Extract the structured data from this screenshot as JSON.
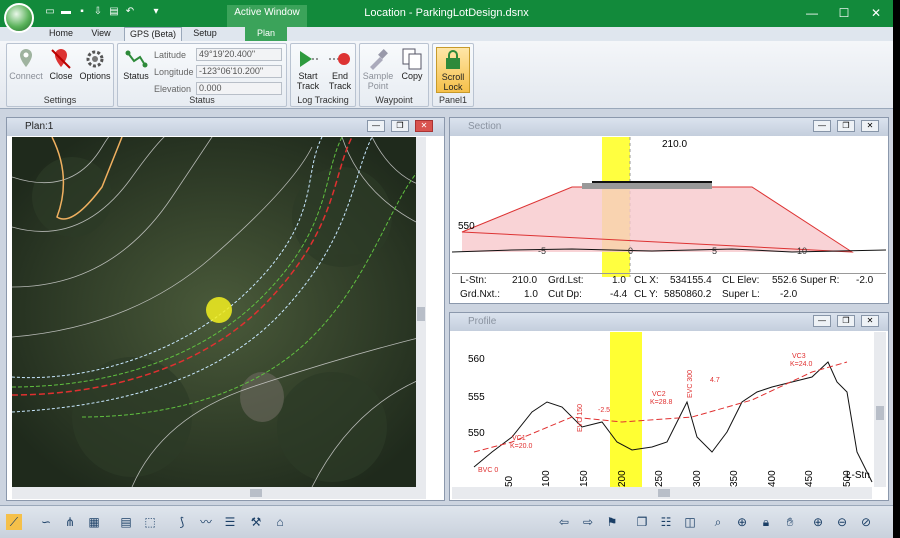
{
  "window": {
    "title": "Location - ParkingLotDesign.dsnx",
    "active_window_label": "Active Window",
    "plan_tab": "Plan"
  },
  "tabs": [
    "Home",
    "View",
    "GPS (Beta)",
    "Setup"
  ],
  "ribbon": {
    "settings": {
      "label": "Settings",
      "connect": "Connect",
      "close": "Close",
      "options": "Options"
    },
    "status": {
      "label": "Status",
      "status_btn": "Status",
      "latitude_label": "Latitude",
      "latitude": "49°19'20.400\"",
      "longitude_label": "Longitude",
      "longitude": "-123°06'10.200\"",
      "elevation_label": "Elevation",
      "elevation": "0.000"
    },
    "log": {
      "label": "Log Tracking",
      "start": "Start Track",
      "end": "End Track"
    },
    "waypoint": {
      "label": "Waypoint",
      "sample": "Sample Point",
      "copy": "Copy"
    },
    "panel": {
      "label": "Panel1",
      "scroll_lock": "Scroll Lock"
    }
  },
  "plan": {
    "title": "Plan:1"
  },
  "section": {
    "title": "Section",
    "station_top": "210.0",
    "elev_label": "550",
    "offsets": [
      "-5",
      "0",
      "5",
      "10"
    ],
    "data": [
      [
        "L-Stn:",
        "210.0",
        "Grd.Lst:",
        "1.0",
        "CL X:",
        "534155.4",
        "CL Elev:",
        "552.6",
        "Super R:",
        "-2.0"
      ],
      [
        "Grd.Nxt.:",
        "1.0",
        "Cut Dp:",
        "-4.4",
        "CL Y:",
        "5850860.2",
        "Super L:",
        "-2.0"
      ]
    ]
  },
  "profile": {
    "title": "Profile",
    "y_ticks": [
      "560",
      "555",
      "550"
    ],
    "x_ticks": [
      "50",
      "100",
      "150",
      "200",
      "250",
      "300",
      "350",
      "400",
      "450",
      "500"
    ],
    "x_label": "L-Stn",
    "annotations": [
      "VC1",
      "K=20.0",
      "VC2",
      "K=28.8",
      "VC3",
      "K=24.0",
      "EVC 150",
      "EVC 300",
      "BVC 0",
      "4.7",
      "-2.5"
    ]
  },
  "colors": {
    "titlebar": "#128a3b",
    "highlight": "#ffff00",
    "design": "#e03030"
  }
}
